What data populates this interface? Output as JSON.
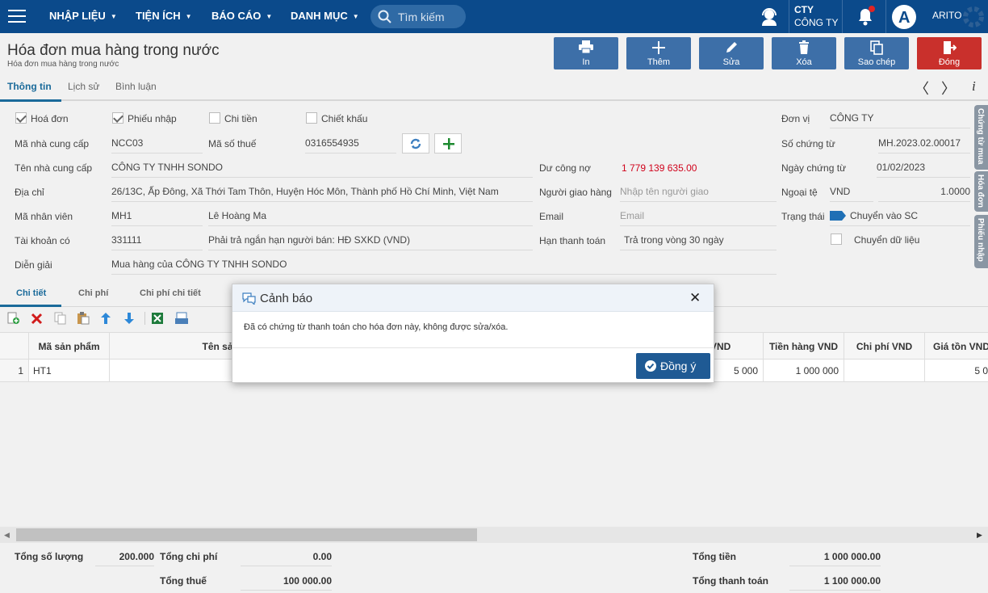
{
  "topbar": {
    "menus": [
      "NHẬP LIỆU",
      "TIỆN ÍCH",
      "BÁO CÁO",
      "DANH MỤC"
    ],
    "search_placeholder": "Tìm kiếm",
    "company_code": "CTY",
    "company_name": "CÔNG TY",
    "user": "ARITO"
  },
  "page": {
    "title": "Hóa đơn mua hàng trong nước",
    "subtitle": "Hóa đơn mua hàng trong nước"
  },
  "toolbar": {
    "print": "In",
    "add": "Thêm",
    "edit": "Sửa",
    "delete": "Xóa",
    "copy": "Sao chép",
    "close": "Đóng"
  },
  "tabs": [
    "Thông tin",
    "Lịch sử",
    "Bình luận"
  ],
  "form": {
    "cb_invoice": "Hoá đơn",
    "cb_receipt": "Phiếu nhập",
    "cb_payment": "Chi tiền",
    "cb_discount": "Chiết khấu",
    "supplier_code_label": "Mã nhà cung cấp",
    "supplier_code": "NCC03",
    "tax_code_label": "Mã số thuế",
    "tax_code": "0316554935",
    "supplier_name_label": "Tên nhà cung cấp",
    "supplier_name": "CÔNG TY TNHH SONDO",
    "address_label": "Địa chỉ",
    "address": "26/13C, Ấp Đông, Xã Thới Tam Thôn, Huyện Hóc Môn, Thành phố Hồ Chí Minh, Việt Nam",
    "employee_label": "Mã nhân viên",
    "employee_code": "MH1",
    "employee_name": "Lê Hoàng Ma",
    "account_label": "Tài khoản có",
    "account_code": "331111",
    "account_name": "Phải trả ngắn hạn người bán: HĐ SXKD (VND)",
    "description_label": "Diễn giải",
    "description": "Mua hàng của CÔNG TY TNHH SONDO",
    "debt_label": "Dư công nợ",
    "debt": "1 779 139 635.00",
    "deliverer_label": "Người giao hàng",
    "deliverer_placeholder": "Nhập tên người giao",
    "email_label": "Email",
    "email_placeholder": "Email",
    "due_label": "Hạn thanh toán",
    "due": "Trả trong vòng 30 ngày",
    "unit_label": "Đơn vị",
    "unit": "CÔNG TY",
    "doc_no_label": "Số chứng từ",
    "doc_no": "MH.2023.02.00017",
    "doc_date_label": "Ngày chứng từ",
    "doc_date": "01/02/2023",
    "currency_label": "Ngoại tệ",
    "currency": "VND",
    "rate": "1.0000",
    "status_label": "Trạng thái",
    "status": "Chuyển vào SC",
    "transfer_label": "Chuyển dữ liệu"
  },
  "side_tabs": [
    "Chứng từ mua",
    "Hóa đơn",
    "Phiếu nhập"
  ],
  "detail_tabs": [
    "Chi tiết",
    "Chi phí",
    "Chi phí chi tiết"
  ],
  "grid": {
    "headers": [
      "Mã sản phẩm",
      "Tên sản phẩ",
      "á VND",
      "Tiền hàng VND",
      "Chi phí VND",
      "Giá tồn VND"
    ],
    "rows": [
      {
        "no": "1",
        "code": "HT1",
        "name": "",
        "price": "5 000",
        "amount": "1 000 000",
        "cost": "",
        "stock": "5 0"
      }
    ]
  },
  "totals": {
    "qty_label": "Tổng số lượng",
    "qty": "200.000",
    "cost_label": "Tổng chi phí",
    "cost": "0.00",
    "tax_label": "Tổng thuế",
    "tax": "100 000.00",
    "money_label": "Tổng tiền",
    "money": "1 000 000.00",
    "pay_label": "Tổng thanh toán",
    "pay": "1 100 000.00"
  },
  "dialog": {
    "title": "Cảnh báo",
    "message": "Đã có chứng từ thanh toán cho hóa đơn này, không được sửa/xóa.",
    "ok": "Đồng ý"
  },
  "colors": {
    "topbar": "#0b4a8b",
    "button": "#3d6fa8",
    "close_button": "#c9302c",
    "debt": "#d0021b",
    "ok_button": "#1f5a94"
  }
}
